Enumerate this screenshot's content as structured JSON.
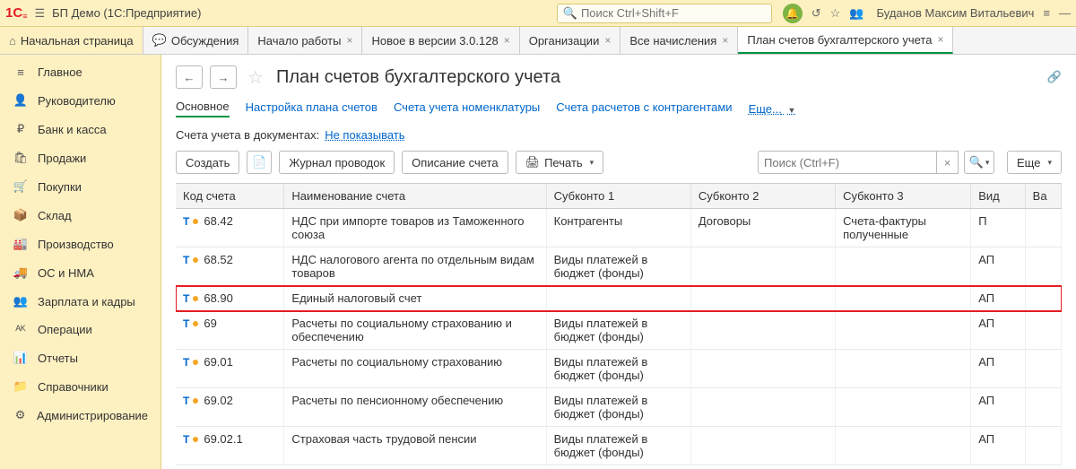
{
  "topbar": {
    "app_title": "БП Демо  (1С:Предприятие)",
    "search_placeholder": "Поиск Ctrl+Shift+F",
    "user": "Буданов Максим Витальевич"
  },
  "tabs": {
    "home": "Начальная страница",
    "items": [
      {
        "label": "Обсуждения",
        "closable": false
      },
      {
        "label": "Начало работы",
        "closable": true
      },
      {
        "label": "Новое в версии 3.0.128",
        "closable": true
      },
      {
        "label": "Организации",
        "closable": true
      },
      {
        "label": "Все начисления",
        "closable": true
      },
      {
        "label": "План счетов бухгалтерского учета",
        "closable": true,
        "active": true
      }
    ]
  },
  "sidebar": [
    {
      "icon": "≡",
      "label": "Главное"
    },
    {
      "icon": "👤",
      "label": "Руководителю"
    },
    {
      "icon": "₽",
      "label": "Банк и касса"
    },
    {
      "icon": "🛍",
      "label": "Продажи"
    },
    {
      "icon": "🛒",
      "label": "Покупки"
    },
    {
      "icon": "📦",
      "label": "Склад"
    },
    {
      "icon": "🏭",
      "label": "Производство"
    },
    {
      "icon": "🚚",
      "label": "ОС и НМА"
    },
    {
      "icon": "👥",
      "label": "Зарплата и кадры"
    },
    {
      "icon": "ᴬᴷ",
      "label": "Операции"
    },
    {
      "icon": "📊",
      "label": "Отчеты"
    },
    {
      "icon": "📁",
      "label": "Справочники"
    },
    {
      "icon": "⚙",
      "label": "Администрирование"
    }
  ],
  "page": {
    "title": "План счетов бухгалтерского учета",
    "subnav": {
      "main": "Основное",
      "links": [
        "Настройка плана счетов",
        "Счета учета номенклатуры",
        "Счета расчетов с контрагентами"
      ],
      "more": "Еще..."
    },
    "docs_label": "Счета учета в документах:",
    "docs_link": "Не показывать",
    "toolbar": {
      "create": "Создать",
      "journal": "Журнал проводок",
      "desc": "Описание счета",
      "print": "Печать",
      "search_placeholder": "Поиск (Ctrl+F)",
      "more": "Еще"
    },
    "columns": [
      "Код счета",
      "Наименование счета",
      "Субконто 1",
      "Субконто 2",
      "Субконто 3",
      "Вид",
      "Ва"
    ],
    "rows": [
      {
        "code": "68.42",
        "name": "НДС при импорте товаров из Таможенного союза",
        "s1": "Контрагенты",
        "s2": "Договоры",
        "s3": "Счета-фактуры полученные",
        "vid": "П"
      },
      {
        "code": "68.52",
        "name": "НДС налогового агента по отдельным видам товаров",
        "s1": "Виды платежей в бюджет (фонды)",
        "s2": "",
        "s3": "",
        "vid": "АП"
      },
      {
        "code": "68.90",
        "name": "Единый налоговый счет",
        "s1": "",
        "s2": "",
        "s3": "",
        "vid": "АП",
        "hl": true
      },
      {
        "code": "69",
        "name": "Расчеты по социальному страхованию и обеспечению",
        "s1": "Виды платежей в бюджет (фонды)",
        "s2": "",
        "s3": "",
        "vid": "АП"
      },
      {
        "code": "69.01",
        "name": "Расчеты по социальному страхованию",
        "s1": "Виды платежей в бюджет (фонды)",
        "s2": "",
        "s3": "",
        "vid": "АП"
      },
      {
        "code": "69.02",
        "name": "Расчеты по пенсионному обеспечению",
        "s1": "Виды платежей в бюджет (фонды)",
        "s2": "",
        "s3": "",
        "vid": "АП"
      },
      {
        "code": "69.02.1",
        "name": "Страховая часть трудовой пенсии",
        "s1": "Виды платежей в бюджет (фонды)",
        "s2": "",
        "s3": "",
        "vid": "АП"
      }
    ]
  }
}
